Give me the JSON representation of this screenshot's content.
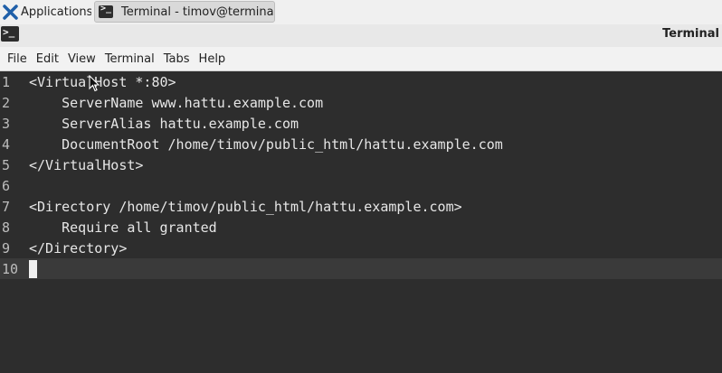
{
  "taskbar": {
    "apps_label": "Applications",
    "terminal_task_label": "Terminal - timov@termina..."
  },
  "window": {
    "title": "Terminal"
  },
  "menu": [
    "File",
    "Edit",
    "View",
    "Terminal",
    "Tabs",
    "Help"
  ],
  "editor": {
    "lines": [
      {
        "num": "1",
        "text": "<VirtualHost *:80>"
      },
      {
        "num": "2",
        "text": "    ServerName www.hattu.example.com"
      },
      {
        "num": "3",
        "text": "    ServerAlias hattu.example.com"
      },
      {
        "num": "4",
        "text": "    DocumentRoot /home/timov/public_html/hattu.example.com"
      },
      {
        "num": "5",
        "text": "</VirtualHost>"
      },
      {
        "num": "6",
        "text": ""
      },
      {
        "num": "7",
        "text": "<Directory /home/timov/public_html/hattu.example.com>"
      },
      {
        "num": "8",
        "text": "    Require all granted"
      },
      {
        "num": "9",
        "text": "</Directory>"
      },
      {
        "num": "10",
        "text": ""
      }
    ],
    "current_line": 10
  },
  "colors": {
    "editor_bg": "#2d2d2d",
    "current_line_bg": "#3a3a3a",
    "text": "#e6e6e6",
    "xfce_blue": "#1f5fa8"
  }
}
